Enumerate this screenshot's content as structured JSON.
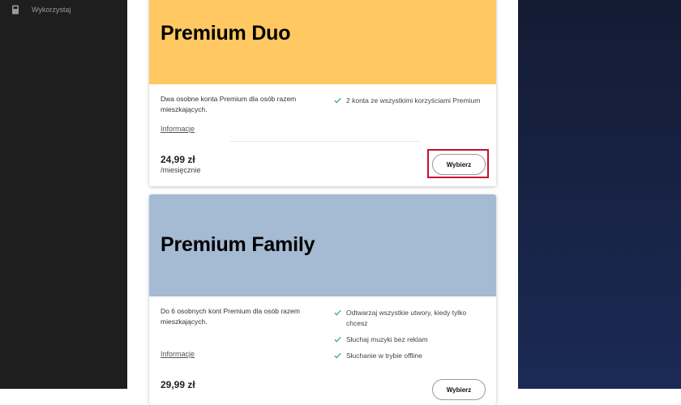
{
  "sidebar": {
    "items": [
      {
        "label": "Wykorzystaj",
        "icon": "gift-card-icon"
      }
    ]
  },
  "plans": [
    {
      "title": "Premium Duo",
      "color": "#ffc862",
      "description": "Dwa osobne konta Premium dla osób razem mieszkających.",
      "info_link": "Informacje",
      "features": [
        "2 konta ze wszystkimi korzyściami Premium"
      ],
      "price": "24,99 zł",
      "period": "/miesięcznie",
      "button_label": "Wybierz"
    },
    {
      "title": "Premium Family",
      "color": "#a5bad3",
      "description": "Do 6 osobnych kont Premium dla osób razem mieszkających.",
      "info_link": "Informacje",
      "features": [
        "Odtwarzaj wszystkie utwory, kiedy tylko chcesz",
        "Słuchaj muzyki bez reklam",
        "Słuchanie w trybie offline"
      ],
      "price": "29,99 zł",
      "button_label": "Wybierz"
    }
  ],
  "colors": {
    "sidebar_bg": "#1e1e1e",
    "check": "#1db954",
    "highlight": "#c8102e"
  }
}
